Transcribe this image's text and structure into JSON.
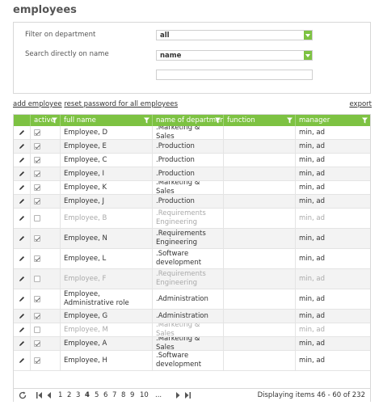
{
  "page": {
    "title": "employees"
  },
  "filters": {
    "department_label": "Filter on department",
    "department_value": "all",
    "search_label": "Search directly on name",
    "search_field_value": "name",
    "search_text": ""
  },
  "actions": {
    "add_employee": "add employee",
    "reset_password": "reset password for all employees",
    "export": "export"
  },
  "grid": {
    "columns": [
      "active",
      "full name",
      "name of department",
      "function",
      "manager"
    ],
    "rows": [
      {
        "active": true,
        "full_name": "Employee, D",
        "department": ".Marketing & Sales",
        "function": "",
        "manager": "min, ad"
      },
      {
        "active": true,
        "full_name": "Employee, E",
        "department": ".Production",
        "function": "",
        "manager": "min, ad"
      },
      {
        "active": true,
        "full_name": "Employee, C",
        "department": ".Production",
        "function": "",
        "manager": "min, ad"
      },
      {
        "active": true,
        "full_name": "Employee, I",
        "department": ".Production",
        "function": "",
        "manager": "min, ad"
      },
      {
        "active": true,
        "full_name": "Employee, K",
        "department": ".Marketing & Sales",
        "function": "",
        "manager": "min, ad"
      },
      {
        "active": true,
        "full_name": "Employee, J",
        "department": ".Production",
        "function": "",
        "manager": "min, ad"
      },
      {
        "active": false,
        "full_name": "Employee, B",
        "department": ".Requirements Engineering",
        "function": "",
        "manager": "min, ad"
      },
      {
        "active": true,
        "full_name": "Employee, N",
        "department": ".Requirements Engineering",
        "function": "",
        "manager": "min, ad"
      },
      {
        "active": true,
        "full_name": "Employee, L",
        "department": ".Software development",
        "function": "",
        "manager": "min, ad"
      },
      {
        "active": false,
        "full_name": "Employee, F",
        "department": ".Requirements Engineering",
        "function": "",
        "manager": "min, ad"
      },
      {
        "active": true,
        "full_name": "Employee, Administrative role",
        "department": ".Administration",
        "function": "",
        "manager": "min, ad"
      },
      {
        "active": true,
        "full_name": "Employee, G",
        "department": ".Administration",
        "function": "",
        "manager": "min, ad"
      },
      {
        "active": false,
        "full_name": "Employee, M",
        "department": ".Marketing & Sales",
        "function": "",
        "manager": "min, ad"
      },
      {
        "active": true,
        "full_name": "Employee, A",
        "department": ".Marketing & Sales",
        "function": "",
        "manager": "min, ad"
      },
      {
        "active": true,
        "full_name": "Employee, H",
        "department": ".Software development",
        "function": "",
        "manager": "min, ad"
      }
    ]
  },
  "pager": {
    "pages": [
      "1",
      "2",
      "3",
      "4",
      "5",
      "6",
      "7",
      "8",
      "9",
      "10",
      "..."
    ],
    "current_page": "4",
    "status": "Displaying items 46 - 60 of 232"
  },
  "colors": {
    "accent": "#7dc242",
    "header_text": "#ffffff"
  }
}
